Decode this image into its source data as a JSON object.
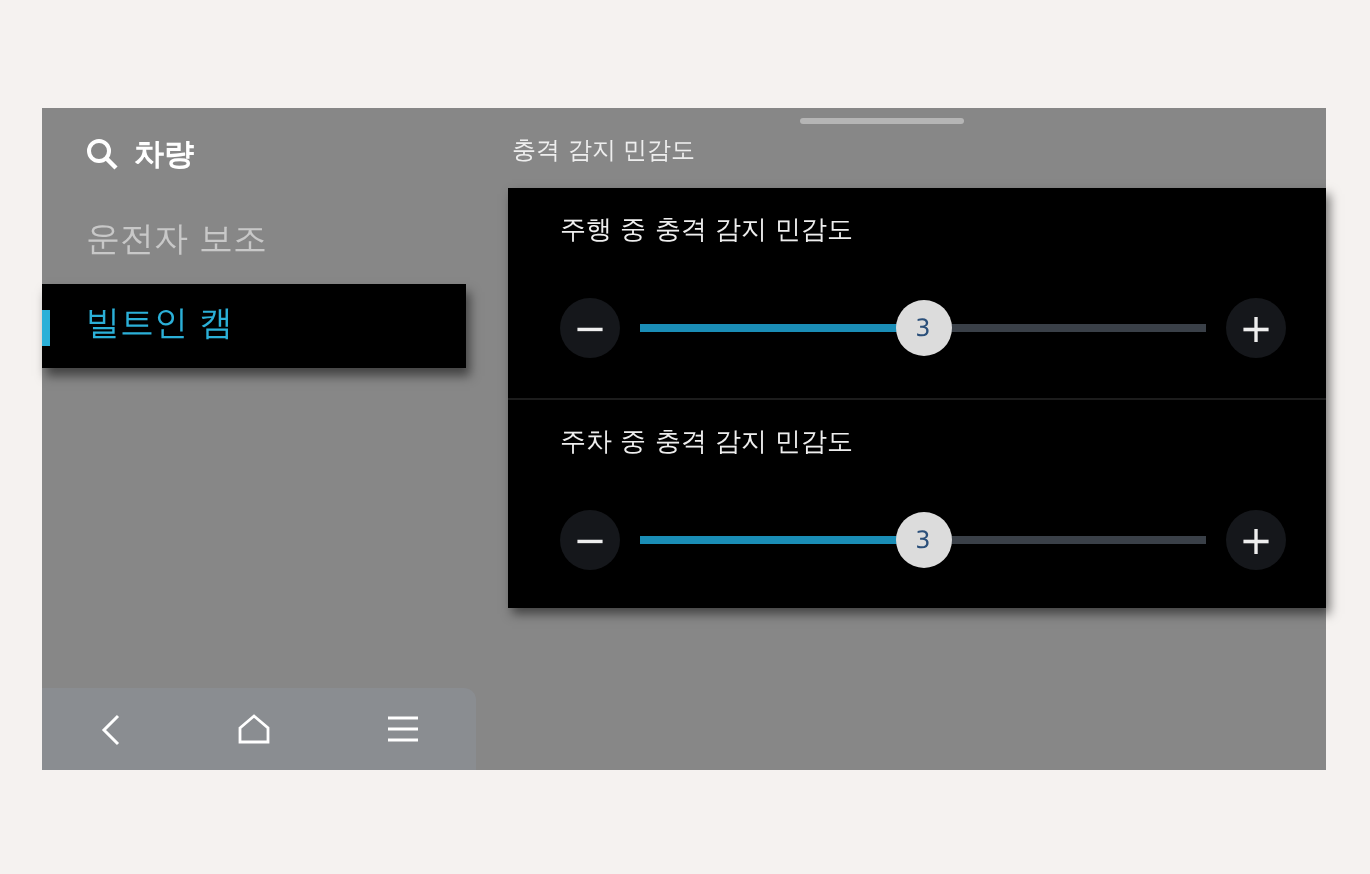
{
  "sidebar": {
    "search_label": "차량",
    "items": [
      {
        "label": "운전자 보조",
        "selected": false
      },
      {
        "label": "빌트인 캠",
        "selected": true
      }
    ]
  },
  "section_title": "충격 감지 민감도",
  "settings": [
    {
      "label": "주행 중 충격 감지 민감도",
      "level": 0.5,
      "value": "3",
      "decrease": "−",
      "increase": "+"
    },
    {
      "label": "주차 중 충격 감지 민감도",
      "level": 0.5,
      "value": "3",
      "decrease": "−",
      "increase": "+"
    }
  ]
}
